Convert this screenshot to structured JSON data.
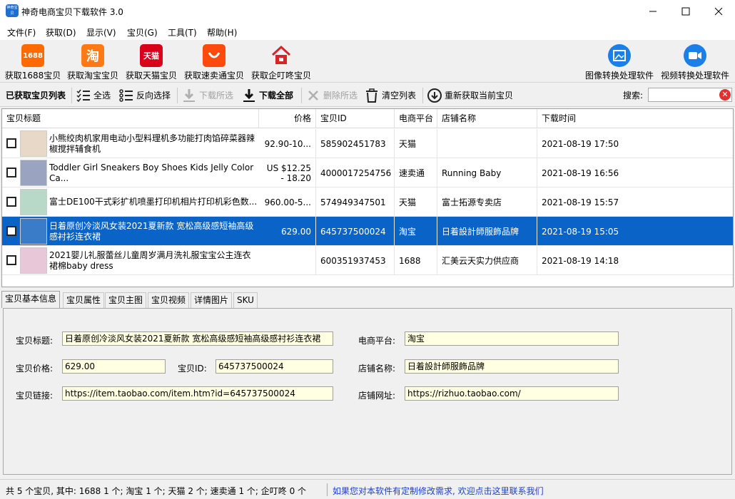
{
  "window": {
    "title": "神奇电商宝贝下载软件 3.0",
    "icon_text": "神奇宝贝"
  },
  "menu": [
    "文件(F)",
    "获取(D)",
    "显示(V)",
    "宝贝(G)",
    "工具(T)",
    "帮助(H)"
  ],
  "toolbar1": {
    "get_1688": "获取1688宝贝",
    "icon_1688": "1688",
    "get_taobao": "获取淘宝宝贝",
    "icon_taobao": "淘",
    "get_tmall": "获取天猫宝贝",
    "icon_tmall": "天猫",
    "get_aliexpress": "获取速卖通宝贝",
    "get_qichacha": "获取企叮咚宝贝",
    "image_tool": "图像转换处理软件",
    "video_tool": "视频转换处理软件"
  },
  "toolbar2": {
    "list_label": "已获取宝贝列表",
    "select_all": "全选",
    "invert": "反向选择",
    "download_selected": "下载所选",
    "download_all": "下载全部",
    "delete_selected": "删除所选",
    "clear_list": "清空列表",
    "refresh": "重新获取当前宝贝",
    "search_label": "搜索:",
    "search_value": ""
  },
  "table": {
    "headers": [
      "宝贝标题",
      "价格",
      "宝贝ID",
      "电商平台",
      "店铺名称",
      "下载时间"
    ],
    "rows": [
      {
        "title": "小熊绞肉机家用电动小型料理机多功能打肉馅碎菜器辣椒搅拌辅食机",
        "price": "92.90-10...",
        "id": "585902451783",
        "platform": "天猫",
        "shop": "",
        "time": "2021-08-19 17:50",
        "selected": false
      },
      {
        "title": "Toddler Girl Sneakers Boy Shoes Kids Jelly Color Ca...",
        "price": "US $12.25 - 18.20",
        "id": "4000017254756",
        "platform": "速卖通",
        "shop": "Running Baby",
        "time": "2021-08-19 16:56",
        "selected": false
      },
      {
        "title": "富士DE100干式彩扩机喷墨打印机相片打印机彩色数...",
        "price": "960.00-5...",
        "id": "574949347501",
        "platform": "天猫",
        "shop": "富士拓源专卖店",
        "time": "2021-08-19 15:57",
        "selected": false
      },
      {
        "title": "日着原创冷淡风女装2021夏新款 宽松高级感短袖高级感衬衫连衣裙",
        "price": "629.00",
        "id": "645737500024",
        "platform": "淘宝",
        "shop": "日着設計師服飾品牌",
        "time": "2021-08-19 15:05",
        "selected": true
      },
      {
        "title": "2021婴儿礼服蕾丝儿童周岁满月洗礼服宝宝公主连衣裙棉baby dress",
        "price": "",
        "id": "600351937453",
        "platform": "1688",
        "shop": "汇美云天实力供应商",
        "time": "2021-08-19 14:18",
        "selected": false
      }
    ]
  },
  "tabs": [
    "宝贝基本信息",
    "宝贝属性",
    "宝贝主图",
    "宝贝视频",
    "详情图片",
    "SKU"
  ],
  "details": {
    "title_label": "宝贝标题:",
    "title_value": "日着原创冷淡风女装2021夏新款 宽松高级感短袖高级感衬衫连衣裙",
    "platform_label": "电商平台:",
    "platform_value": "淘宝",
    "price_label": "宝贝价格:",
    "price_value": "629.00",
    "id_label": "宝贝ID:",
    "id_value": "645737500024",
    "shop_label": "店铺名称:",
    "shop_value": "日着設計師服飾品牌",
    "link_label": "宝贝链接:",
    "link_value": "https://item.taobao.com/item.htm?id=645737500024",
    "shop_url_label": "店铺网址:",
    "shop_url_value": "https://rizhuo.taobao.com/"
  },
  "status": {
    "summary": "共 5 个宝贝, 其中: 1688 1 个; 淘宝 1 个; 天猫 2 个; 速卖通 1 个; 企叮咚 0 个",
    "link": "如果您对本软件有定制修改需求, 欢迎点击这里联系我们"
  },
  "colors": {
    "selection": "#0a64c8",
    "tooltip_bg": "#ffffe1",
    "link": "#1a3fd6"
  }
}
